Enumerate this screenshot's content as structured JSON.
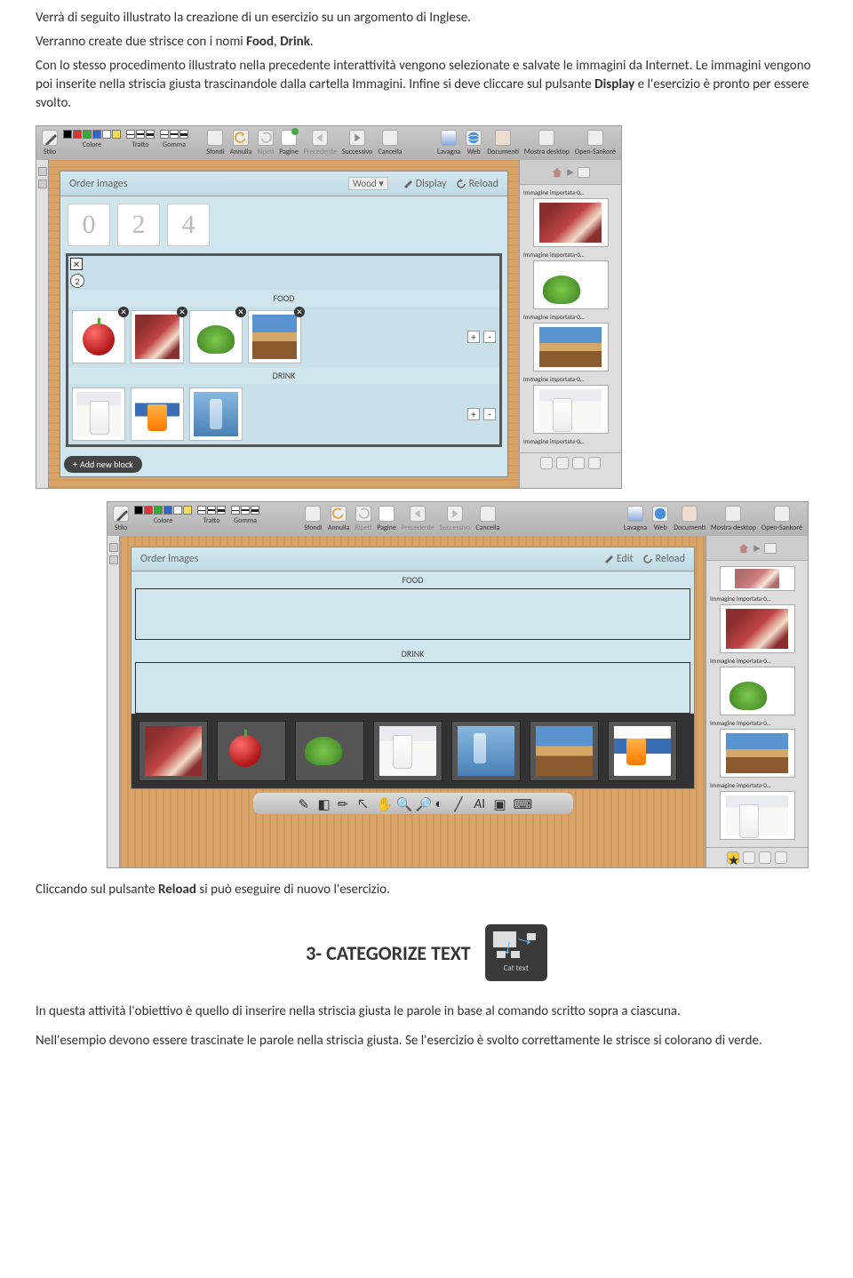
{
  "intro": {
    "p1a": "Verrà di seguito illustrato la creazione di un esercizio su un argomento di Inglese.",
    "p2a": "Verranno create due strisce con i nomi ",
    "p2_food": "Food",
    "p2_sep": ", ",
    "p2_drink": "Drink",
    "p2_end": ".",
    "p3": "Con lo stesso procedimento illustrato nella precedente interattività vengono selezionate e salvate le immagini da Internet. Le immagini vengono poi inserite nella striscia giusta trascinandole dalla cartella Immagini. Infine si deve cliccare sul pulsante ",
    "p3_display": "Display",
    "p3_end": " e l'esercizio è pronto per essere svolto."
  },
  "toolbar": {
    "stilo": "Stilo",
    "colore": "Colore",
    "tratto": "Tratto",
    "gomma": "Gomma",
    "sfondi": "Sfondi",
    "annulla": "Annulla",
    "ripeti": "Ripeti",
    "pagine": "Pagine",
    "precedente": "Precedente",
    "successivo": "Successivo",
    "cancella": "Cancella",
    "lavagna": "Lavagna",
    "web": "Web",
    "documenti": "Documenti",
    "mostra": "Mostra desktop",
    "open": "Open-Sankoré"
  },
  "app1": {
    "title": "Order images",
    "theme": "Wood",
    "display": "Display",
    "reload": "Reload",
    "card0": "0",
    "card2": "2",
    "card4": "4",
    "strip_num": "2",
    "food_label": "FOOD",
    "drink_label": "DRINK",
    "plus": "+",
    "minus": "-",
    "addblock": "Add new block"
  },
  "rightpanel": {
    "item_label": "Immagine importata-0…"
  },
  "app2": {
    "title": "Order images",
    "edit": "Edit",
    "reload": "Reload",
    "food_label": "FOOD",
    "drink_label": "DRINK"
  },
  "caption": {
    "p1a": "Cliccando sul pulsante ",
    "p1_reload": "Reload",
    "p1b": " si può eseguire di nuovo l'esercizio."
  },
  "section": {
    "heading": "3- CATEGORIZE TEXT",
    "icon_label": "Cat text"
  },
  "body": {
    "p1": "In questa attività l'obiettivo è quello di inserire nella striscia giusta le parole in base al comando scritto sopra a ciascuna.",
    "p2": "Nell'esempio devono essere trascinate le parole nella striscia giusta. Se l'esercizio è svolto correttamente le strisce si colorano di verde."
  },
  "colors": {
    "black": "#000",
    "red": "#d33",
    "green": "#3a3",
    "blue": "#36c",
    "white": "#fff",
    "yellow": "#ed5"
  }
}
